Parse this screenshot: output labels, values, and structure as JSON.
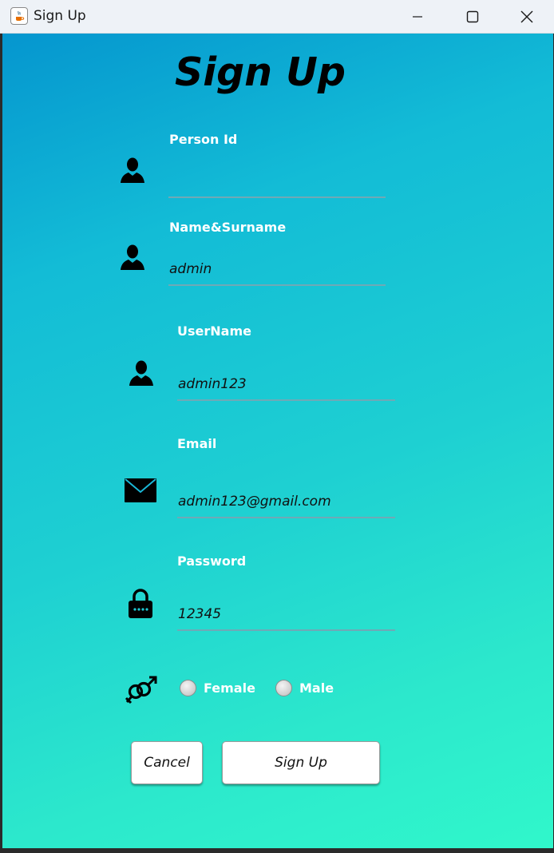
{
  "window": {
    "title": "Sign Up",
    "app_icon": "java-cup-icon"
  },
  "form": {
    "heading": "Sign Up",
    "fields": [
      {
        "label": "Person Id",
        "value": "",
        "icon": "person-icon"
      },
      {
        "label": "Name&Surname",
        "value": "admin",
        "icon": "person-icon"
      },
      {
        "label": "UserName",
        "value": "admin123",
        "icon": "person-icon"
      },
      {
        "label": "Email",
        "value": "admin123@gmail.com",
        "icon": "envelope-icon"
      },
      {
        "label": "Password",
        "value": "12345",
        "icon": "lock-icon"
      }
    ],
    "gender": {
      "icon": "gender-symbol-icon",
      "options": [
        "Female",
        "Male"
      ]
    },
    "buttons": {
      "cancel": "Cancel",
      "signup": "Sign Up"
    }
  },
  "colors": {
    "gradient_start": "#0596cf",
    "gradient_end": "#30f7cb",
    "label_text": "#ffffff",
    "underline": "#6fa9b6"
  }
}
